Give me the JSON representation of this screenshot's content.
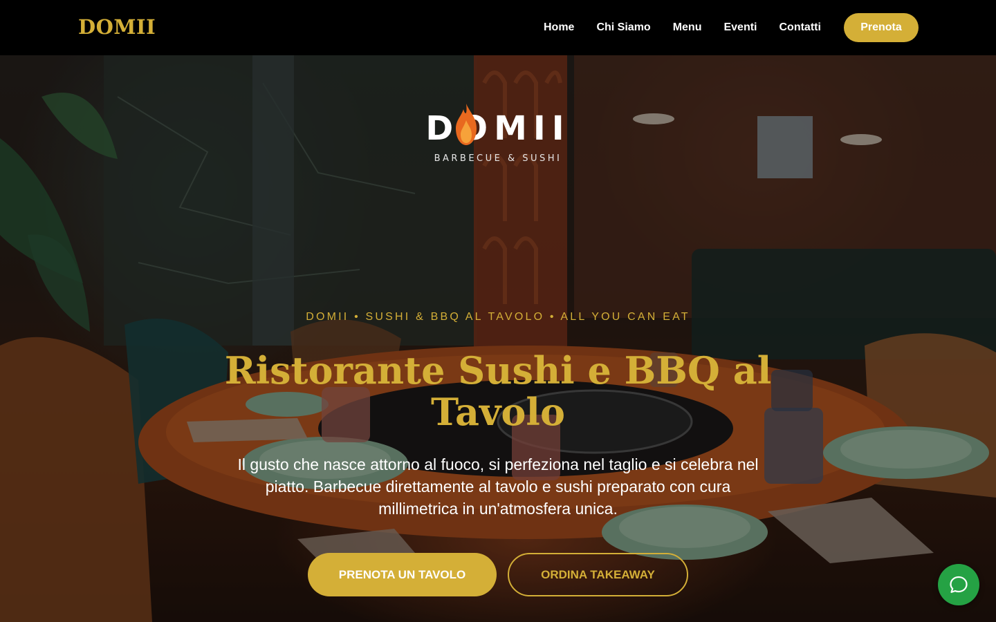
{
  "header": {
    "brand": "DOMII",
    "nav": [
      "Home",
      "Chi Siamo",
      "Menu",
      "Eventi",
      "Contatti"
    ],
    "cta": "Prenota"
  },
  "hero": {
    "logo": {
      "word": "DOMII",
      "subtitle": "BARBECUE & SUSHI"
    },
    "tagline": "DOMII • SUSHI & BBQ AL TAVOLO • ALL YOU CAN EAT",
    "title": "Ristorante Sushi e BBQ al Tavolo",
    "lead": "Il gusto che nasce attorno al fuoco, si perfeziona nel taglio e si celebra nel piatto. Barbecue direttamente al tavolo e sushi preparato con cura millimetrica in un'atmosfera unica.",
    "buttons": {
      "primary": "PRENOTA UN TAVOLO",
      "secondary": "ORDINA TAKEAWAY"
    }
  },
  "chat": {
    "icon": "chat-bubble-icon"
  },
  "colors": {
    "gold": "#d4af37",
    "header_bg": "#000000",
    "chat_green": "#25a244",
    "flame": "#e8691f"
  }
}
